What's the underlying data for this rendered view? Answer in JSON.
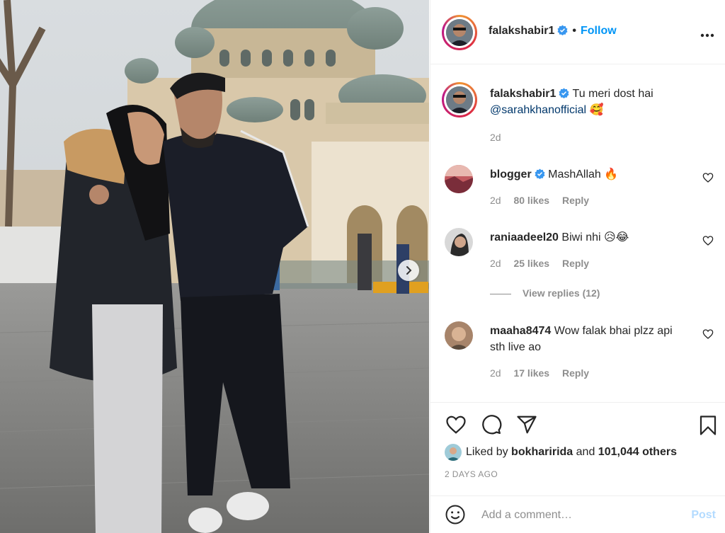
{
  "post": {
    "author": "falakshabir1",
    "follow_label": "Follow",
    "more_icon": "more-horizontal-icon",
    "caption": {
      "username": "falakshabir1",
      "text": "Tu meri dost hai",
      "mention": "@sarahkhanofficial",
      "emoji": "🥰",
      "time": "2d"
    }
  },
  "comments": [
    {
      "username": "blogger",
      "verified": true,
      "text": "MashAllah 🔥",
      "time": "2d",
      "likes": "80 likes",
      "reply": "Reply"
    },
    {
      "username": "raniaadeel20",
      "verified": false,
      "text": "Biwi nhi 😥😂",
      "time": "2d",
      "likes": "25 likes",
      "reply": "Reply"
    },
    {
      "username": "maaha8474",
      "verified": false,
      "text": "Wow falak bhai plzz api sth live ao",
      "time": "2d",
      "likes": "17 likes",
      "reply": "Reply"
    }
  ],
  "view_replies": "View replies (12)",
  "likes": {
    "prefix": "Liked by",
    "user": "bokharirida",
    "middle": "and",
    "count": "101,044 others"
  },
  "time_ago": "2 DAYS AGO",
  "add_comment": {
    "placeholder": "Add a comment…",
    "post_label": "Post"
  },
  "colors": {
    "accent": "#0095f6",
    "verified": "#3897f0",
    "muted": "#8e8e8e",
    "post_disabled": "#b3dbff"
  }
}
